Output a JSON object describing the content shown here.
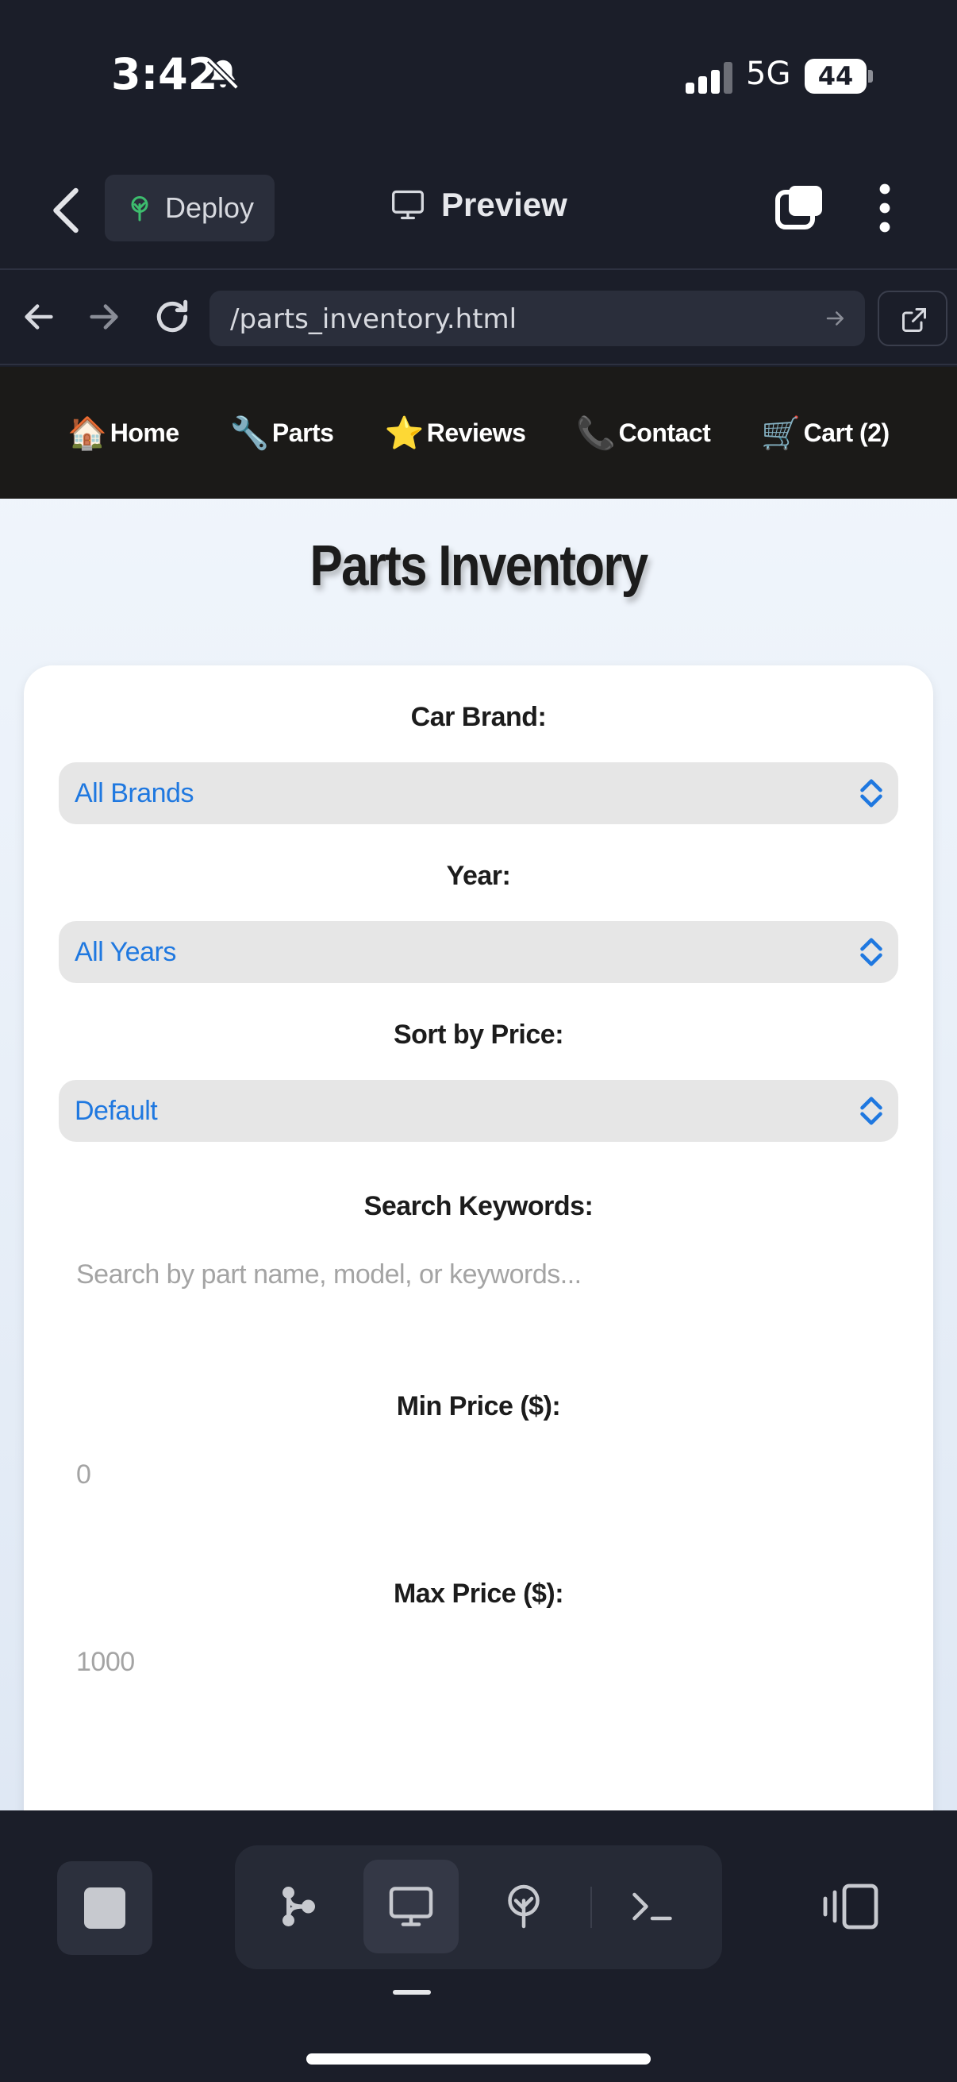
{
  "status_bar": {
    "time": "3:42",
    "network": "5G",
    "battery": "44"
  },
  "app_header": {
    "deploy_label": "Deploy",
    "preview_label": "Preview"
  },
  "browser": {
    "url": "/parts_inventory.html"
  },
  "site_nav": [
    {
      "emoji": "🏠",
      "label": "Home"
    },
    {
      "emoji": "🔧",
      "label": "Parts"
    },
    {
      "emoji": "⭐",
      "label": "Reviews"
    },
    {
      "emoji": "📞",
      "label": "Contact"
    },
    {
      "emoji": "🛒",
      "label": "Cart (2)"
    }
  ],
  "page": {
    "title": "Parts Inventory"
  },
  "filters": {
    "brand": {
      "label": "Car Brand:",
      "value": "All Brands"
    },
    "year": {
      "label": "Year:",
      "value": "All Years"
    },
    "sort": {
      "label": "Sort by Price:",
      "value": "Default"
    },
    "search": {
      "label": "Search Keywords:",
      "placeholder": "Search by part name, model, or keywords..."
    },
    "min_price": {
      "label": "Min Price ($):",
      "placeholder": "0"
    },
    "max_price": {
      "label": "Max Price ($):",
      "placeholder": "1000"
    }
  },
  "colors": {
    "accent": "#1f78e0",
    "app_bg": "#1b1e29",
    "site_nav_bg": "#1b1a18",
    "deploy_icon": "#3dbd6e"
  },
  "icons": [
    "bell-slash-icon",
    "back-chevron-icon",
    "deploy-tree-icon",
    "monitor-icon",
    "copy-icon",
    "more-vertical-icon",
    "arrow-left-icon",
    "arrow-right-icon",
    "reload-icon",
    "open-external-icon",
    "stop-icon",
    "graph-icon",
    "antenna-icon",
    "terminal-icon",
    "device-toggle-icon"
  ]
}
